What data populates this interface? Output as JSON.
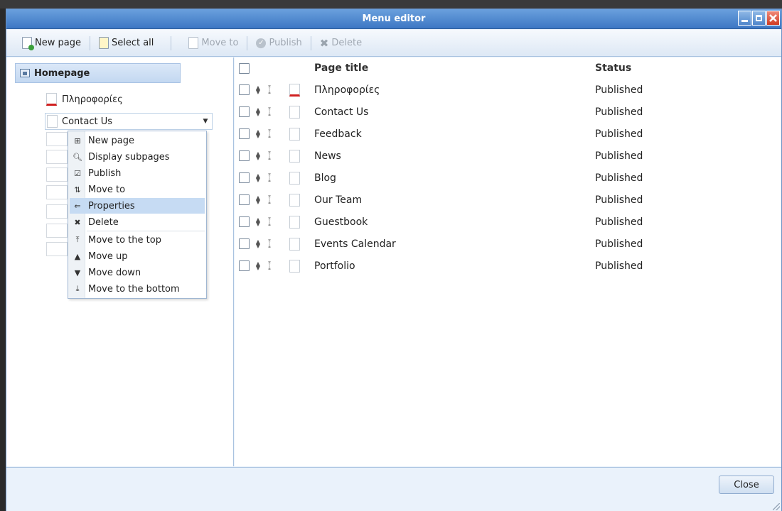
{
  "window": {
    "title": "Menu editor"
  },
  "toolbar": {
    "new_page": "New page",
    "select_all": "Select all",
    "move_to": "Move to",
    "publish": "Publish",
    "delete": "Delete"
  },
  "tree": {
    "root": "Homepage",
    "first_item": "Πληροφορίες",
    "combo_value": "Contact Us"
  },
  "context_menu": {
    "items": [
      {
        "label": "New page",
        "icon": "plus-box-icon"
      },
      {
        "label": "Display subpages",
        "icon": "magnifier-icon"
      },
      {
        "label": "Publish",
        "icon": "check-box-icon"
      },
      {
        "label": "Move to",
        "icon": "move-arrows-icon"
      },
      {
        "label": "Properties",
        "icon": "properties-icon"
      },
      {
        "label": "Delete",
        "icon": "x-icon"
      },
      {
        "label": "Move to the top",
        "icon": "arrow-top-icon"
      },
      {
        "label": "Move up",
        "icon": "arrow-up-icon"
      },
      {
        "label": "Move down",
        "icon": "arrow-down-icon"
      },
      {
        "label": "Move to the bottom",
        "icon": "arrow-bottom-icon"
      }
    ]
  },
  "list": {
    "col_title": "Page title",
    "col_status": "Status",
    "rows": [
      {
        "title": "Πληροφορίες",
        "status": "Published"
      },
      {
        "title": "Contact Us",
        "status": "Published"
      },
      {
        "title": "Feedback",
        "status": "Published"
      },
      {
        "title": "News",
        "status": "Published"
      },
      {
        "title": "Blog",
        "status": "Published"
      },
      {
        "title": "Our Team",
        "status": "Published"
      },
      {
        "title": "Guestbook",
        "status": "Published"
      },
      {
        "title": "Events Calendar",
        "status": "Published"
      },
      {
        "title": "Portfolio",
        "status": "Published"
      }
    ]
  },
  "footer": {
    "close": "Close"
  },
  "colors": {
    "titlebar": "#3d77c4",
    "highlight": "#c6dbf3",
    "window_bg": "#eaf2fb"
  }
}
